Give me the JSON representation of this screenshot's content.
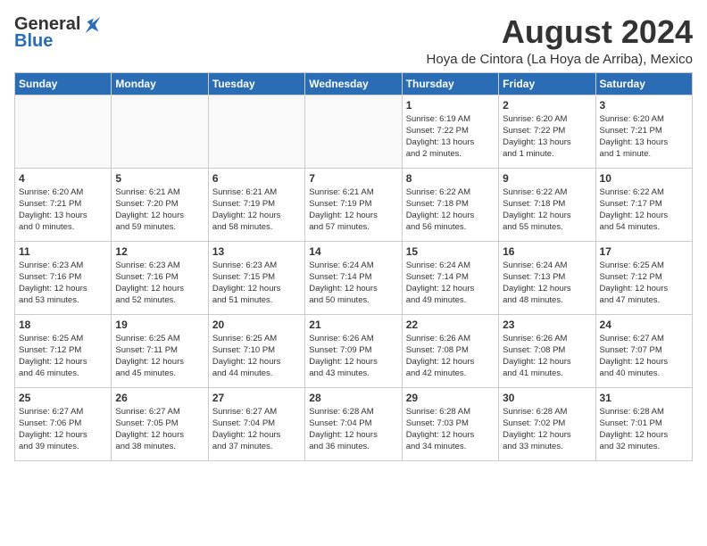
{
  "header": {
    "logo_general": "General",
    "logo_blue": "Blue",
    "month_year": "August 2024",
    "location": "Hoya de Cintora (La Hoya de Arriba), Mexico"
  },
  "weekdays": [
    "Sunday",
    "Monday",
    "Tuesday",
    "Wednesday",
    "Thursday",
    "Friday",
    "Saturday"
  ],
  "weeks": [
    [
      {
        "day": "",
        "info": ""
      },
      {
        "day": "",
        "info": ""
      },
      {
        "day": "",
        "info": ""
      },
      {
        "day": "",
        "info": ""
      },
      {
        "day": "1",
        "info": "Sunrise: 6:19 AM\nSunset: 7:22 PM\nDaylight: 13 hours\nand 2 minutes."
      },
      {
        "day": "2",
        "info": "Sunrise: 6:20 AM\nSunset: 7:22 PM\nDaylight: 13 hours\nand 1 minute."
      },
      {
        "day": "3",
        "info": "Sunrise: 6:20 AM\nSunset: 7:21 PM\nDaylight: 13 hours\nand 1 minute."
      }
    ],
    [
      {
        "day": "4",
        "info": "Sunrise: 6:20 AM\nSunset: 7:21 PM\nDaylight: 13 hours\nand 0 minutes."
      },
      {
        "day": "5",
        "info": "Sunrise: 6:21 AM\nSunset: 7:20 PM\nDaylight: 12 hours\nand 59 minutes."
      },
      {
        "day": "6",
        "info": "Sunrise: 6:21 AM\nSunset: 7:19 PM\nDaylight: 12 hours\nand 58 minutes."
      },
      {
        "day": "7",
        "info": "Sunrise: 6:21 AM\nSunset: 7:19 PM\nDaylight: 12 hours\nand 57 minutes."
      },
      {
        "day": "8",
        "info": "Sunrise: 6:22 AM\nSunset: 7:18 PM\nDaylight: 12 hours\nand 56 minutes."
      },
      {
        "day": "9",
        "info": "Sunrise: 6:22 AM\nSunset: 7:18 PM\nDaylight: 12 hours\nand 55 minutes."
      },
      {
        "day": "10",
        "info": "Sunrise: 6:22 AM\nSunset: 7:17 PM\nDaylight: 12 hours\nand 54 minutes."
      }
    ],
    [
      {
        "day": "11",
        "info": "Sunrise: 6:23 AM\nSunset: 7:16 PM\nDaylight: 12 hours\nand 53 minutes."
      },
      {
        "day": "12",
        "info": "Sunrise: 6:23 AM\nSunset: 7:16 PM\nDaylight: 12 hours\nand 52 minutes."
      },
      {
        "day": "13",
        "info": "Sunrise: 6:23 AM\nSunset: 7:15 PM\nDaylight: 12 hours\nand 51 minutes."
      },
      {
        "day": "14",
        "info": "Sunrise: 6:24 AM\nSunset: 7:14 PM\nDaylight: 12 hours\nand 50 minutes."
      },
      {
        "day": "15",
        "info": "Sunrise: 6:24 AM\nSunset: 7:14 PM\nDaylight: 12 hours\nand 49 minutes."
      },
      {
        "day": "16",
        "info": "Sunrise: 6:24 AM\nSunset: 7:13 PM\nDaylight: 12 hours\nand 48 minutes."
      },
      {
        "day": "17",
        "info": "Sunrise: 6:25 AM\nSunset: 7:12 PM\nDaylight: 12 hours\nand 47 minutes."
      }
    ],
    [
      {
        "day": "18",
        "info": "Sunrise: 6:25 AM\nSunset: 7:12 PM\nDaylight: 12 hours\nand 46 minutes."
      },
      {
        "day": "19",
        "info": "Sunrise: 6:25 AM\nSunset: 7:11 PM\nDaylight: 12 hours\nand 45 minutes."
      },
      {
        "day": "20",
        "info": "Sunrise: 6:25 AM\nSunset: 7:10 PM\nDaylight: 12 hours\nand 44 minutes."
      },
      {
        "day": "21",
        "info": "Sunrise: 6:26 AM\nSunset: 7:09 PM\nDaylight: 12 hours\nand 43 minutes."
      },
      {
        "day": "22",
        "info": "Sunrise: 6:26 AM\nSunset: 7:08 PM\nDaylight: 12 hours\nand 42 minutes."
      },
      {
        "day": "23",
        "info": "Sunrise: 6:26 AM\nSunset: 7:08 PM\nDaylight: 12 hours\nand 41 minutes."
      },
      {
        "day": "24",
        "info": "Sunrise: 6:27 AM\nSunset: 7:07 PM\nDaylight: 12 hours\nand 40 minutes."
      }
    ],
    [
      {
        "day": "25",
        "info": "Sunrise: 6:27 AM\nSunset: 7:06 PM\nDaylight: 12 hours\nand 39 minutes."
      },
      {
        "day": "26",
        "info": "Sunrise: 6:27 AM\nSunset: 7:05 PM\nDaylight: 12 hours\nand 38 minutes."
      },
      {
        "day": "27",
        "info": "Sunrise: 6:27 AM\nSunset: 7:04 PM\nDaylight: 12 hours\nand 37 minutes."
      },
      {
        "day": "28",
        "info": "Sunrise: 6:28 AM\nSunset: 7:04 PM\nDaylight: 12 hours\nand 36 minutes."
      },
      {
        "day": "29",
        "info": "Sunrise: 6:28 AM\nSunset: 7:03 PM\nDaylight: 12 hours\nand 34 minutes."
      },
      {
        "day": "30",
        "info": "Sunrise: 6:28 AM\nSunset: 7:02 PM\nDaylight: 12 hours\nand 33 minutes."
      },
      {
        "day": "31",
        "info": "Sunrise: 6:28 AM\nSunset: 7:01 PM\nDaylight: 12 hours\nand 32 minutes."
      }
    ]
  ]
}
